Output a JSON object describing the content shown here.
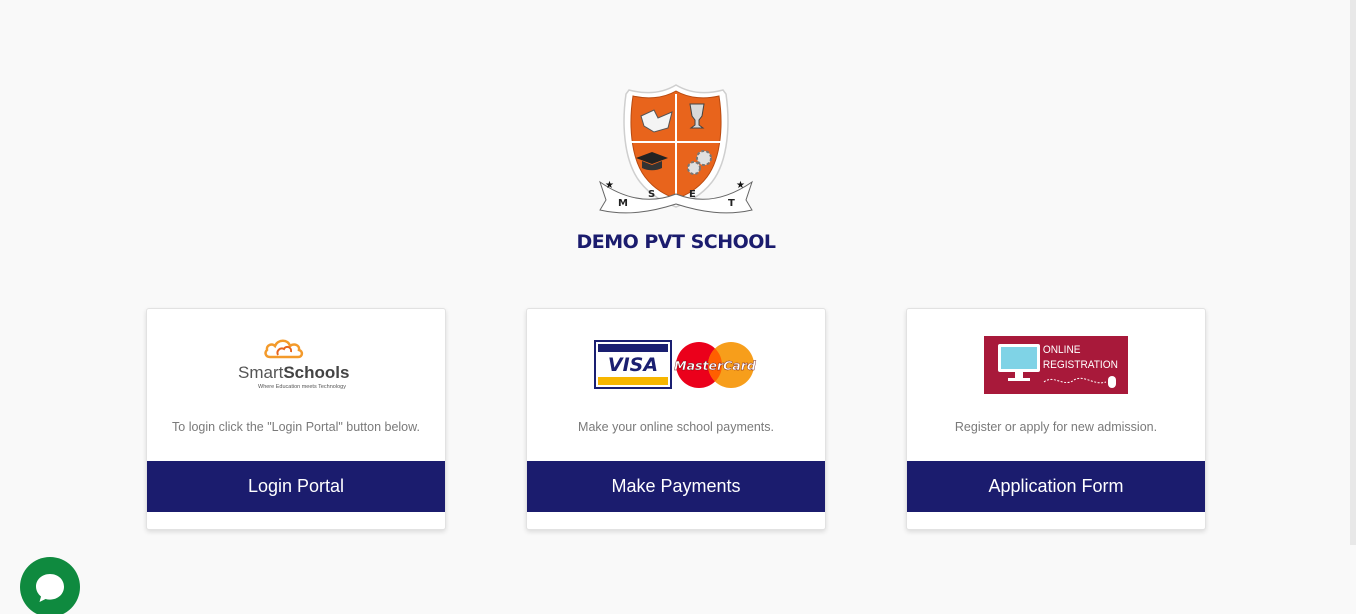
{
  "school": {
    "name": "DEMO PVT SCHOOL",
    "crest_letters": [
      "M",
      "S",
      "E",
      "T"
    ]
  },
  "cards": [
    {
      "logo_text_light": "Smart",
      "logo_text_bold": "Schools",
      "logo_tagline": "Where Education meets Technology",
      "description": "To login click the \"Login Portal\" button below.",
      "button_label": "Login Portal"
    },
    {
      "logo_visa": "VISA",
      "logo_mastercard": "MasterCard",
      "description": "Make your online school payments.",
      "button_label": "Make Payments"
    },
    {
      "logo_line1": "ONLINE",
      "logo_line2": "REGISTRATION",
      "description": "Register or apply for new admission.",
      "button_label": "Application Form"
    }
  ],
  "colors": {
    "primary": "#1b1c6e",
    "background": "#f9f9f9",
    "crest_orange": "#e8641c",
    "chat_green": "#0f8a3f",
    "registration_red": "#a8193a",
    "smartschools_orange": "#f39a2b"
  },
  "icons": {
    "chat": "chat-bubble-icon",
    "crest": "school-crest-logo"
  }
}
